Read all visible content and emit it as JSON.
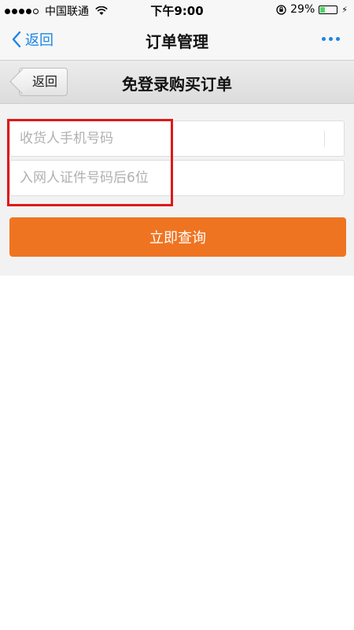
{
  "status_bar": {
    "carrier": "中国联通",
    "time": "下午9:00",
    "battery_percent": "29%",
    "battery_level": 0.29,
    "signal_bars": 4,
    "icons": [
      "signal-icon",
      "wifi-icon",
      "rotation-lock-icon",
      "battery-icon",
      "charging-icon"
    ]
  },
  "nav": {
    "back_label": "返回",
    "title": "订单管理",
    "more_icon": "more-dots-icon",
    "accent_color": "#1a86e5"
  },
  "sub_header": {
    "back_label": "返回",
    "title": "免登录购买订单"
  },
  "form": {
    "phone_placeholder": "收货人手机号码",
    "phone_value": "",
    "id_placeholder": "入网人证件号码后6位",
    "id_value": "",
    "submit_label": "立即查询",
    "submit_color": "#ef7421",
    "highlight_color": "#e01818"
  }
}
